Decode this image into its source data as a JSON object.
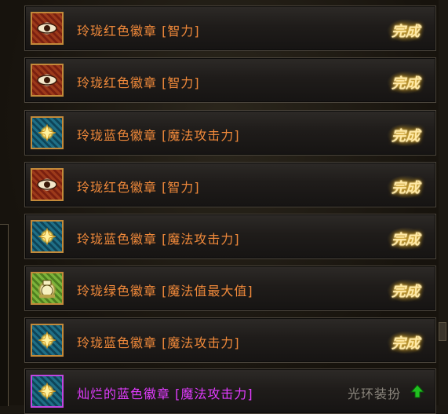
{
  "items": [
    {
      "name": "玲珑红色徽章 [智力]",
      "type": "red",
      "status": "完成"
    },
    {
      "name": "玲珑红色徽章 [智力]",
      "type": "red",
      "status": "完成"
    },
    {
      "name": "玲珑蓝色徽章 [魔法攻击力]",
      "type": "blue",
      "status": "完成"
    },
    {
      "name": "玲珑红色徽章 [智力]",
      "type": "red",
      "status": "完成"
    },
    {
      "name": "玲珑蓝色徽章 [魔法攻击力]",
      "type": "blue",
      "status": "完成"
    },
    {
      "name": "玲珑绿色徽章 [魔法值最大值]",
      "type": "green",
      "status": "完成"
    },
    {
      "name": "玲珑蓝色徽章 [魔法攻击力]",
      "type": "blue",
      "status": "完成"
    },
    {
      "name": "灿烂的蓝色徽章 [魔法攻击力]",
      "type": "purple",
      "status": "光环装扮",
      "status_icon": "green-up-arrow-icon"
    }
  ],
  "colors": {
    "item_name": "#f0893a",
    "rare_item_name": "#e23cff",
    "done": "#ffe9a6",
    "status_gray": "#8a857c",
    "arrow": "#20c020"
  }
}
